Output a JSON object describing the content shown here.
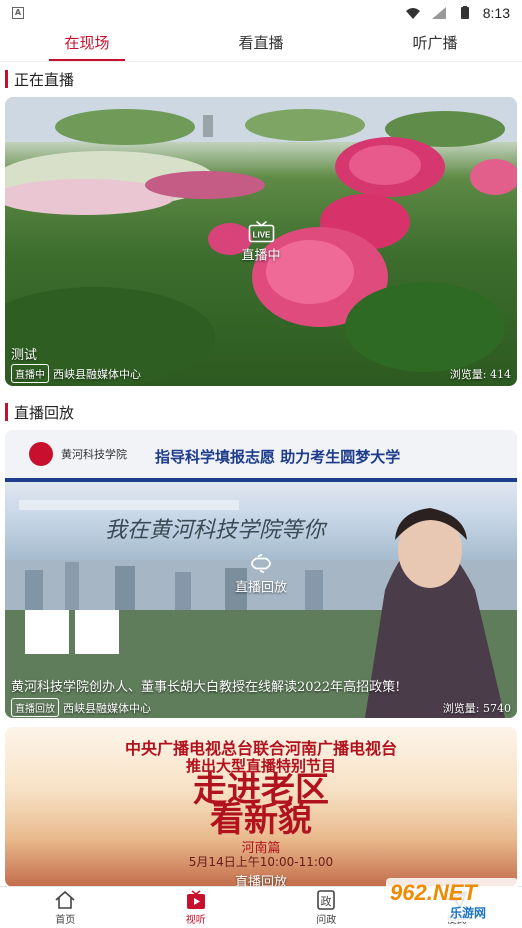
{
  "status_bar": {
    "time": "8:13"
  },
  "tabs": [
    {
      "label": "在现场",
      "active": true
    },
    {
      "label": "看直播",
      "active": false
    },
    {
      "label": "听广播",
      "active": false
    }
  ],
  "sections": {
    "live": {
      "title": "正在直播"
    },
    "replay": {
      "title": "直播回放"
    }
  },
  "live_card": {
    "badge_label": "直播中",
    "title": "测试",
    "pill": "直播中",
    "source": "西峡县融媒体中心",
    "views": "浏览量: 414"
  },
  "replay_card": {
    "header_school": "黄河科技学院",
    "header_slogan": "指导科学填报志愿 助力考生圆梦大学",
    "banner_text": "我在黄河科技学院等你",
    "badge_label": "直播回放",
    "title": "黄河科技学院创办人、董事长胡大白教授在线解读2022年高招政策!",
    "pill": "直播回放",
    "source": "西峡县融媒体中心",
    "views": "浏览量: 5740"
  },
  "third_card": {
    "line1": "中央广播电视总台联合河南广播电视台",
    "line2": "推出大型直播特别节目",
    "headline1": "走进老区",
    "headline2": "看新貌",
    "subhead": "河南篇",
    "time_line": "5月14日上午10:00-11:00",
    "badge_label": "直播回放"
  },
  "bottom_nav": [
    {
      "label": "首页",
      "icon": "home-icon",
      "active": false
    },
    {
      "label": "视听",
      "icon": "video-icon",
      "active": true
    },
    {
      "label": "问政",
      "icon": "politics-icon",
      "active": false
    },
    {
      "label": "便民",
      "icon": "send-icon",
      "active": false
    }
  ],
  "watermark": {
    "number": "962.NET",
    "text": "乐游网"
  },
  "colors": {
    "accent": "#c8102e"
  }
}
